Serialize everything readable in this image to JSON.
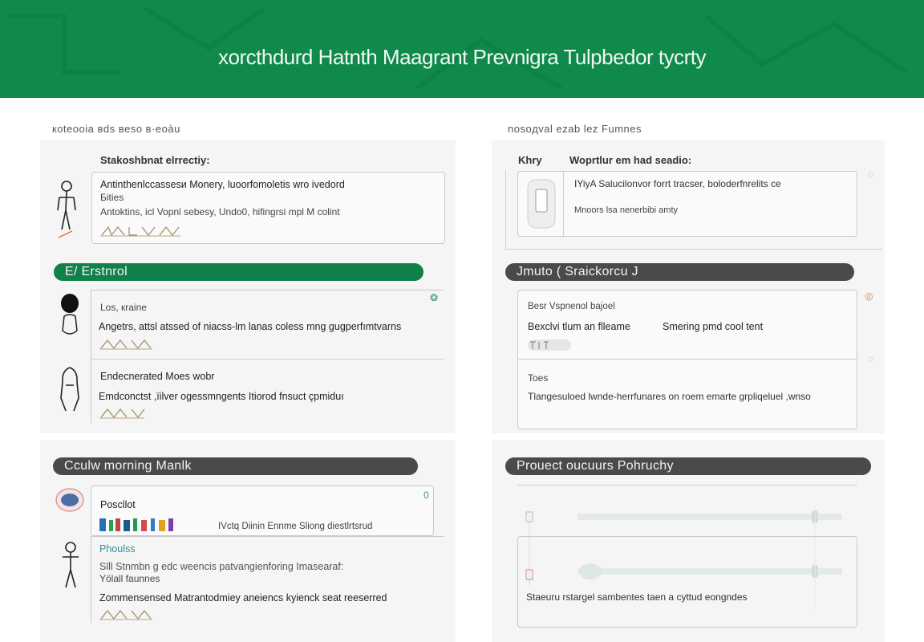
{
  "header": {
    "title": "хorcthdurd Hatnth Maagrant Prevnigra Tulpbedor tycrty"
  },
  "left_column": {
    "label": "кoteooia вds вeso в·eoàu",
    "section1": {
      "heading": "Stakoshbnat elrrectiy:",
      "card": {
        "line1": "Antinthenlcсassesи Monery, luoorfomoletis wro  ivedord",
        "line2": "Бities",
        "line3": "Antoktins, іcl Vopnl sebesy, Undo0, hifingrsi  mpl М colint"
      }
    },
    "section2": {
      "pill": "E/ Erstnrol",
      "row1": {
        "title": "Los, кraine",
        "text": "Angetrs, attsl atssed of niacss-lm lanas coless  mng gugperfımtvarns"
      },
      "row2": {
        "title": "Endecnerated  Moes wobr",
        "text": "Emdconctst ,їіlver ogessmngents Itiorod fnsuct çpmiduı"
      }
    },
    "section3": {
      "pill": "Cculw morning Manlk",
      "card": {
        "title": "Poscllot",
        "swatch_caption": "IVctq Diinin Ennme  Slіong diestlrtsrud",
        "corner": "0"
      },
      "row2": {
        "title": "Phoulss",
        "text1": "Slll Stnmbn g edc weencis patvangienforing Imasearaf:",
        "text2": "Yölall faunnes",
        "text3": "Zommensensed Matrantodmiey  aneiencs kyienck seat reeserred"
      }
    }
  },
  "right_column": {
    "label": "nosoдval  ezab  lez   Fumnes",
    "section1": {
      "heading_a": "Khry",
      "heading_b": "Woprtlur em had seadio:",
      "card": {
        "line1": "IYiyA  Salucilonvor forrt tracser, boloderfnrelits ce",
        "line2": "Mnoors  lsa  nenerbibi  amty"
      }
    },
    "section2": {
      "pill": "Jmuto (  Sraickorcu J",
      "row1": {
        "title": "Besr Vspnenol bajoel",
        "text_a": "Bexclvi  tlum an  flleame",
        "text_b": "Smering pmd cool tent"
      },
      "row2": {
        "title": "Toes",
        "text": "Tlangesuloed  lwnde-herrfunares on roem  emarte grpliqeluel  ,wnso"
      }
    },
    "section3": {
      "pill": "Prouect  oucuurs  Pohruchy",
      "card": {
        "caption": "Staeuru  rstargel sambentes taen a cyttud eongndes"
      }
    }
  },
  "colors": {
    "header_green": "#0f8a4a",
    "pill_green": "#11804a",
    "pill_dark": "#4a4a4a",
    "panel_bg": "#f5f5f5"
  },
  "swatch_colors": [
    "#2a6fb5",
    "#27a05a",
    "#c2404a",
    "#1d5a8a",
    "#1e9a52",
    "#d04a4a",
    "#2e7bbf",
    "#e0a020",
    "#7b3fa0"
  ]
}
